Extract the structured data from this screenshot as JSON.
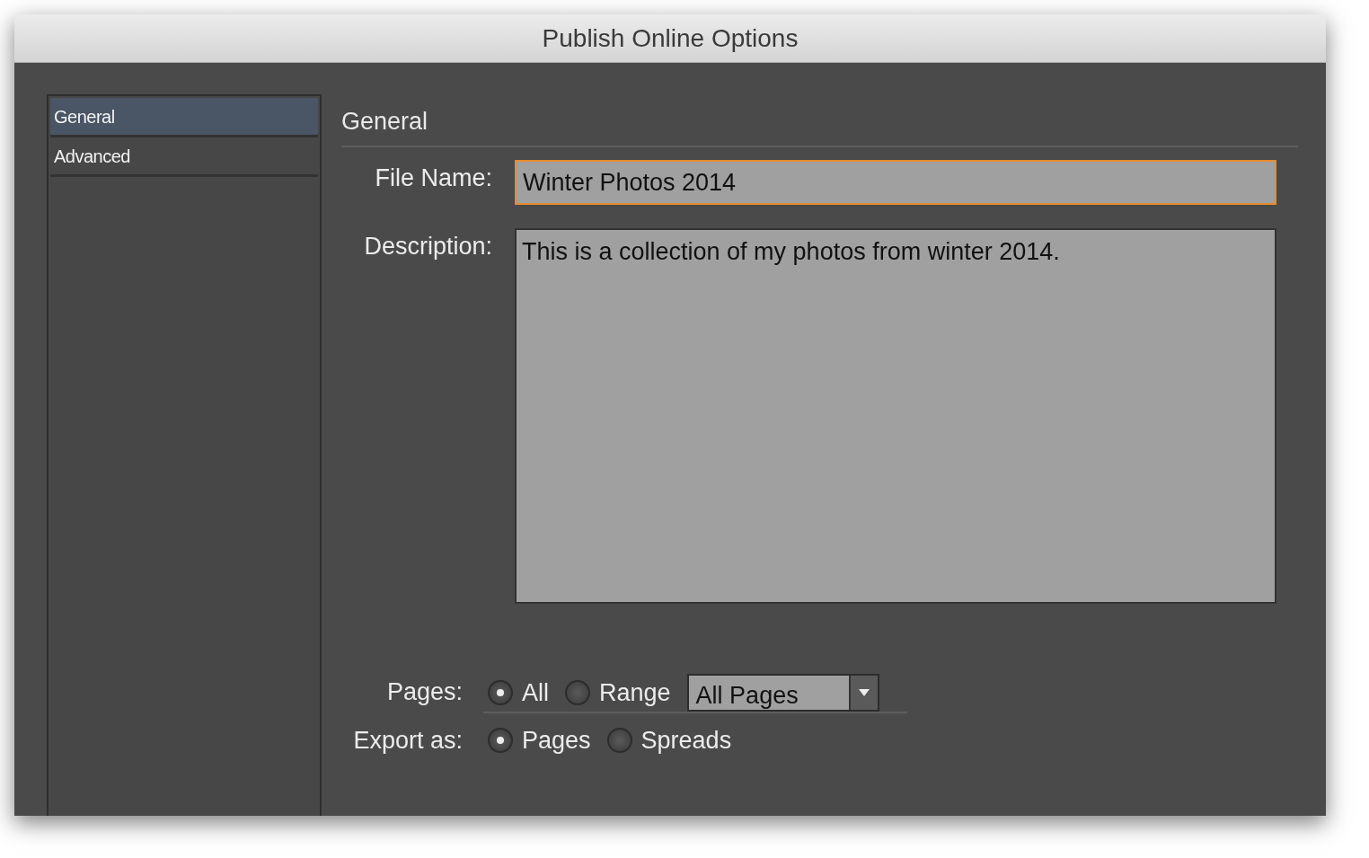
{
  "window": {
    "title": "Publish Online Options"
  },
  "sidebar": {
    "items": [
      {
        "label": "General",
        "selected": true
      },
      {
        "label": "Advanced",
        "selected": false
      }
    ]
  },
  "section_title": "General",
  "file_name": {
    "label": "File Name:",
    "value": "Winter Photos 2014",
    "focused": true
  },
  "description": {
    "label": "Description:",
    "value": "This is a collection of my photos from winter 2014."
  },
  "pages": {
    "label": "Pages:",
    "options": [
      {
        "label": "All",
        "selected": true
      },
      {
        "label": "Range",
        "selected": false
      }
    ],
    "range_select": {
      "value": "All Pages"
    }
  },
  "export_as": {
    "label": "Export as:",
    "options": [
      {
        "label": "Pages",
        "selected": true
      },
      {
        "label": "Spreads",
        "selected": false
      }
    ]
  }
}
